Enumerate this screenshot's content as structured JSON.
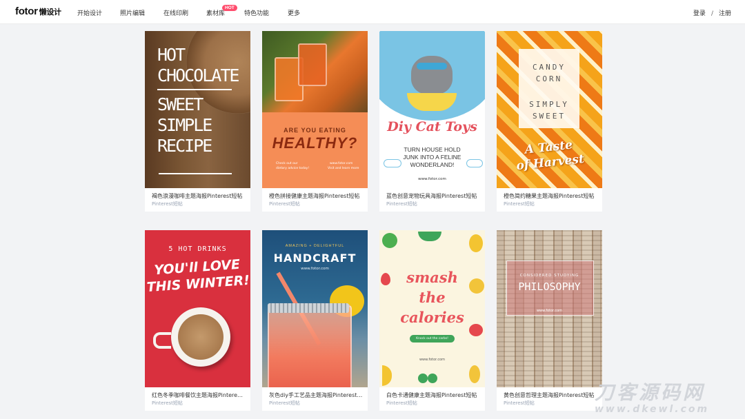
{
  "header": {
    "logo": "fotor",
    "logo_sub": "懒设计",
    "nav": [
      "开始设计",
      "照片编辑",
      "在线印刷",
      "素材库",
      "特色功能",
      "更多"
    ],
    "hot_badge": "HOT",
    "login": "登录",
    "separator": "/",
    "register": "注册"
  },
  "cards": [
    {
      "title": "褐色浪漫咖啡主题海报Pinterest短帖",
      "sub": "Pinterest短帖",
      "art": {
        "l1": "HOT",
        "l2": "CHOCOLATE",
        "l3": "SWEET",
        "l4": "SIMPLE",
        "l5": "RECIPE"
      }
    },
    {
      "title": "橙色拼接健康主题海报Pinterest短帖",
      "sub": "Pinterest短帖",
      "art": {
        "l1": "ARE YOU EATING",
        "l2": "HEALTHY?",
        "l3": "Check out our",
        "l4": "dietary advice today!",
        "l5": "www.fotor.com",
        "l6": "Visit and learn more"
      }
    },
    {
      "title": "蓝色创意宠物玩具海报Pinterest短帖",
      "sub": "Pinterest短帖",
      "art": {
        "l1": "Diy Cat Toys",
        "l2": "TURN HOUSE HOLD",
        "l3": "JUNK INTO A FELINE",
        "l4": "WONDERLAND!",
        "l5": "www.fotor.com"
      }
    },
    {
      "title": "橙色简约糖果主题海报Pinterest短帖",
      "sub": "Pinterest短帖",
      "art": {
        "l1": "CANDY",
        "l2": "CORN",
        "l3": "SIMPLY",
        "l4": "SWEET",
        "l5": "A Taste",
        "l6": "of Harvest"
      }
    },
    {
      "title": "红色冬季咖啡餐饮主题海报Pinterest短帖",
      "sub": "Pinterest短帖",
      "art": {
        "l1": "5 HOT DRINKS",
        "l2": "YOU'll LOVE",
        "l3": "THIS WINTER!"
      }
    },
    {
      "title": "灰色diy手工艺品主题海报Pinterest短帖",
      "sub": "Pinterest短帖",
      "art": {
        "l1": "AMAZING + DELIGHTFUL",
        "l2": "HANDCRAFT",
        "l3": "www.fotor.com"
      }
    },
    {
      "title": "白色卡通健康主题海报Pinterest短帖",
      "sub": "Pinterest短帖",
      "art": {
        "l1": "smash",
        "l2": "the",
        "l3": "calories",
        "l4": "Knock out the carbs!",
        "l5": "www.fotor.com"
      }
    },
    {
      "title": "黄色创意哲理主题海报Pinterest短帖",
      "sub": "Pinterest短帖",
      "art": {
        "l1": "CONSIDERED STUDYING",
        "l2": "PHILOSOPHY",
        "l3": "www.fotor.com"
      }
    }
  ],
  "watermark": {
    "line1": "刀客源码网",
    "line2": "www.dkewl.com"
  },
  "colors": {
    "hot": "#ff4d6d",
    "subtitle": "#9aa4b4",
    "background": "#f2f3f5"
  }
}
